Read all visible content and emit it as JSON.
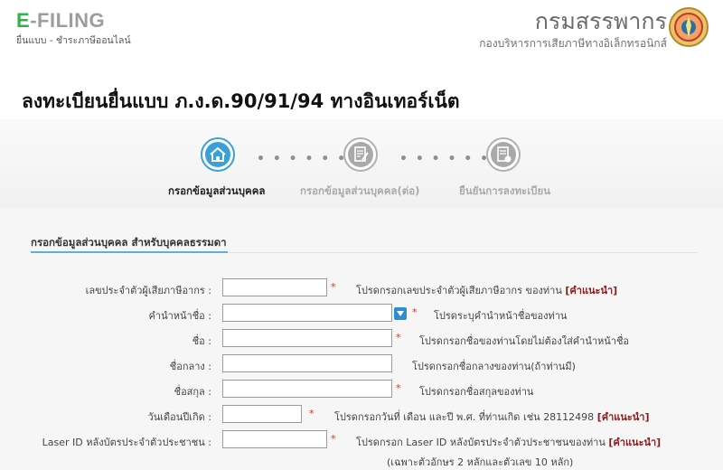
{
  "header": {
    "logo_prefix": "E",
    "logo_rest": "-FILING",
    "tagline": "ยื่นแบบ - ชำระภาษีออนไลน์",
    "org_name": "กรมสรรพากร",
    "org_sub": "กองบริหารการเสียภาษีทางอิเล็กทรอนิกส์"
  },
  "page": {
    "title": "ลงทะเบียนยื่นแบบ ภ.ง.ด.90/91/94 ทางอินเทอร์เน็ต"
  },
  "steps": [
    {
      "label": "กรอกข้อมูลส่วนบุคคล",
      "active": true,
      "icon": "home-icon"
    },
    {
      "label": "กรอกข้อมูลส่วนบุคคล(ต่อ)",
      "active": false,
      "icon": "document-edit-icon"
    },
    {
      "label": "ยืนยันการลงทะเบียน",
      "active": false,
      "icon": "document-check-icon"
    }
  ],
  "step_dots": "• • • • • • • •",
  "form": {
    "section_title": "กรอกข้อมูลส่วนบุคคล สำหรับบุคคลธรรมดา",
    "required_mark": "*",
    "fields": [
      {
        "label": "เลขประจำตัวผู้เสียภาษีอากร :",
        "value": "",
        "hint": "โปรดกรอกเลขประจำตัวผู้เสียภาษีอากร ของท่าน",
        "link": "[คำแนะนำ]",
        "required": true
      },
      {
        "label": "คำนำหน้าชื่อ :",
        "value": "",
        "hint": "โปรดระบุคำนำหน้าชื่อของท่าน",
        "link": "",
        "required": true
      },
      {
        "label": "ชื่อ :",
        "value": "",
        "hint": "โปรดกรอกชื่อของท่านโดยไม่ต้องใส่คำนำหน้าชื่อ",
        "link": "",
        "required": true
      },
      {
        "label": "ชื่อกลาง :",
        "value": "",
        "hint": "โปรดกรอกชื่อกลางของท่าน(ถ้าท่านมี)",
        "link": "",
        "required": false
      },
      {
        "label": "ชื่อสกุล :",
        "value": "",
        "hint": "โปรดกรอกชื่อสกุลของท่าน",
        "link": "",
        "required": true
      },
      {
        "label": "วันเดือนปีเกิด :",
        "value": "",
        "hint": "โปรดกรอกวันที่ เดือน และปี พ.ศ. ที่ท่านเกิด เช่น 28112498",
        "link": "[คำแนะนำ]",
        "required": true
      },
      {
        "label": "Laser ID หลังบัตรประจำตัวประชาชน :",
        "value": "",
        "hint": "โปรดกรอก Laser ID หลังบัตรประจำตัวประชาชนของท่าน",
        "link": "[คำแนะนำ]",
        "required": true
      }
    ],
    "laser_note": "(เฉพาะตัวอักษร 2 หลักและตัวเลข 10 หลัก)"
  },
  "colors": {
    "brand_green": "#2db34a",
    "active_step": "#3aa0d8",
    "link_red": "#8b1a1a"
  }
}
